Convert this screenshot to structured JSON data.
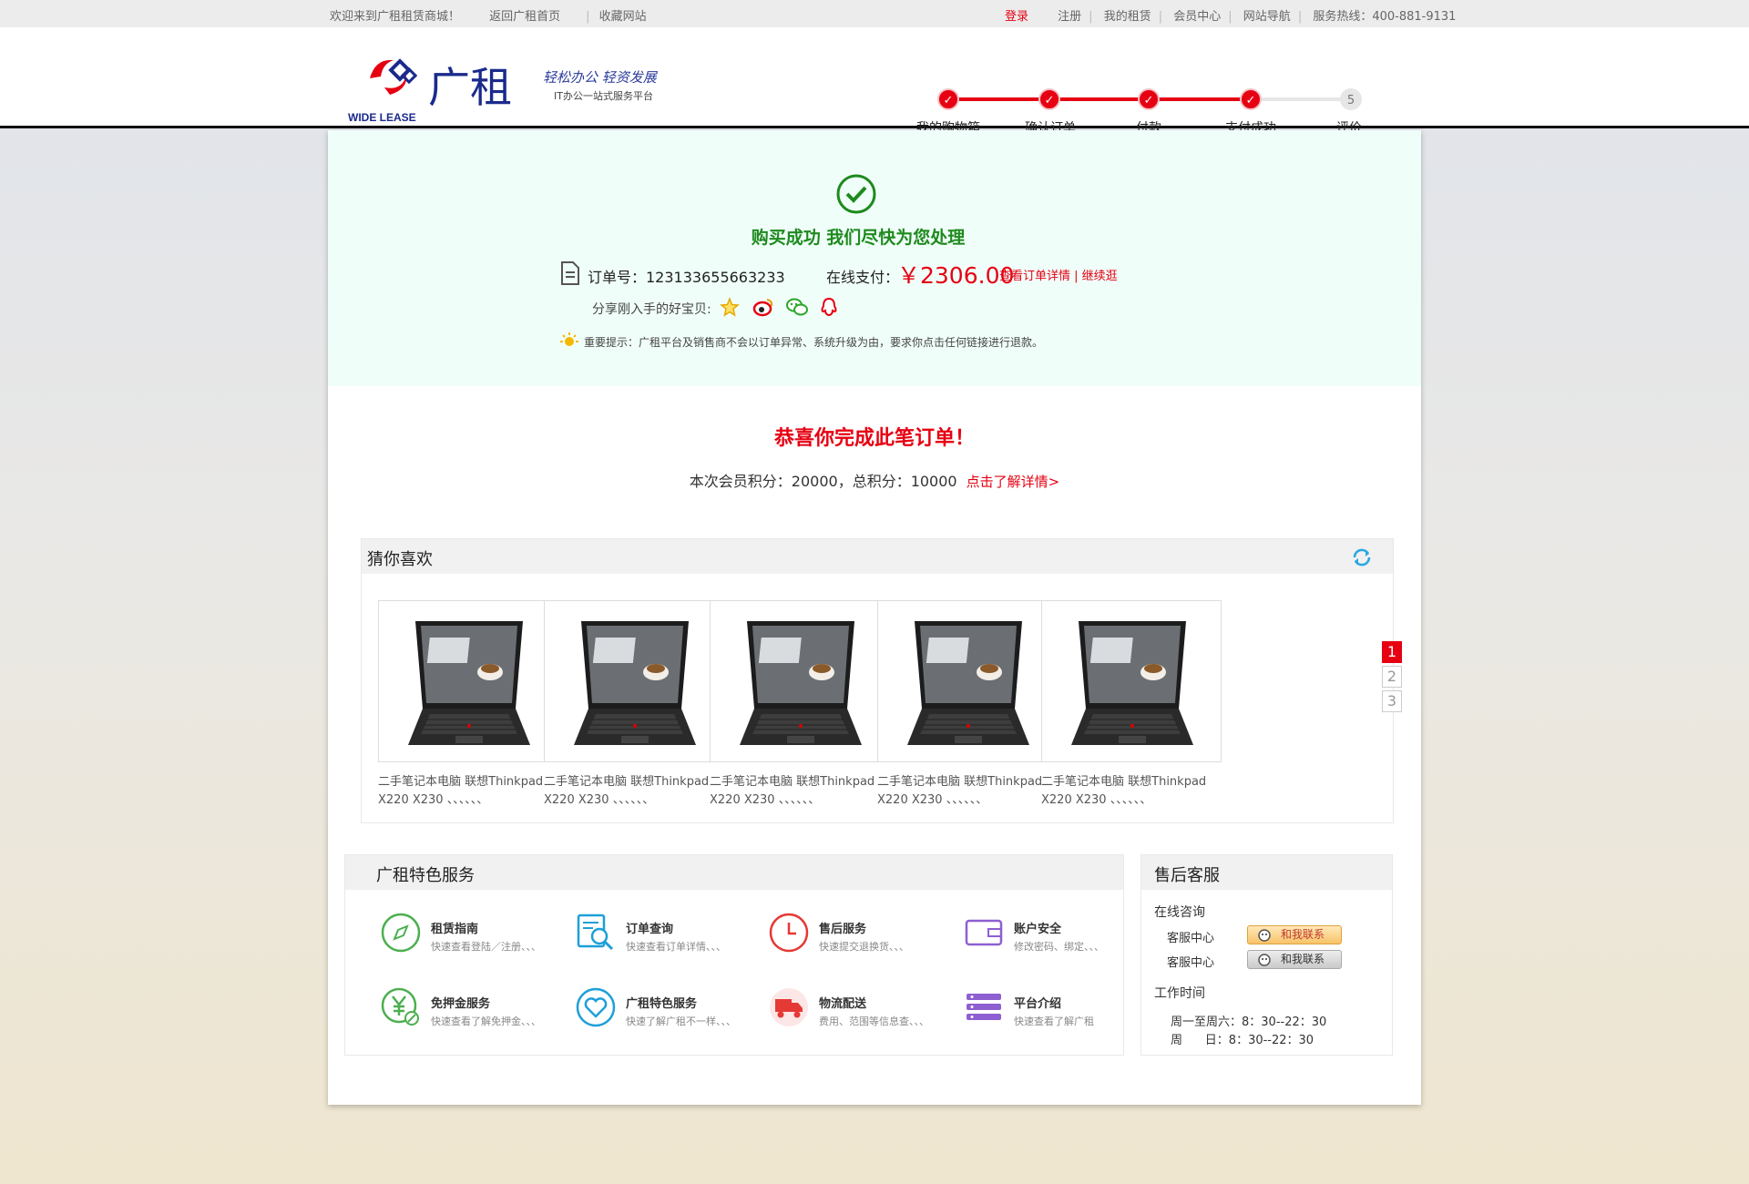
{
  "topbar": {
    "welcome": "欢迎来到广租租赁商城！",
    "home": "返回广租首页",
    "favorite": "收藏网站",
    "login": "登录",
    "register": "注册",
    "my_lease": "我的租赁",
    "member": "会员中心",
    "nav": "网站导航",
    "hotline": "服务热线：400-881-9131"
  },
  "header": {
    "logo_en": "WIDE LEASE",
    "logo_cn": "广租",
    "slogan_1": "轻松办公 轻资发展",
    "slogan_2": "IT办公一站式服务平台"
  },
  "steps": [
    {
      "label": "我的购物箱",
      "state": "done"
    },
    {
      "label": "确认订单",
      "state": "done"
    },
    {
      "label": "付款",
      "state": "done"
    },
    {
      "label": "支付成功",
      "state": "current"
    },
    {
      "label": "评价",
      "state": "todo",
      "num": "5"
    }
  ],
  "success": {
    "title": "购买成功 我们尽快为您处理",
    "order_label": "订单号：123133655663233",
    "pay_label": "在线支付：",
    "amount": "￥2306.00",
    "links": "查看订单详情 | 继续逛",
    "share_label": "分享刚入手的好宝贝:",
    "tip": "重要提示：广租平台及销售商不会以订单异常、系统升级为由，要求你点击任何链接进行退款。"
  },
  "congrats": {
    "title": "恭喜你完成此笔订单！",
    "points": "本次会员积分：20000，总积分：10000",
    "more": "点击了解详情>"
  },
  "guess": {
    "title": "猜你喜欢",
    "products": [
      {
        "name": "二手笔记本电脑 联想Thinkpad X220 X230 、、、、、、"
      },
      {
        "name": "二手笔记本电脑 联想Thinkpad X220 X230 、、、、、、"
      },
      {
        "name": "二手笔记本电脑 联想Thinkpad X220 X230 、、、、、、"
      },
      {
        "name": "二手笔记本电脑 联想Thinkpad X220 X230 、、、、、、"
      },
      {
        "name": "二手笔记本电脑 联想Thinkpad X220 X230 、、、、、、"
      }
    ],
    "pages": [
      "1",
      "2",
      "3"
    ]
  },
  "services": {
    "title": "广租特色服务",
    "items": [
      {
        "title": "租赁指南",
        "desc": "快速查看登陆／注册、、、",
        "icon": "compass-icon",
        "color": "#4caf50"
      },
      {
        "title": "订单查询",
        "desc": "快速查看订单详情、、、",
        "icon": "order-search-icon",
        "color": "#1e9fd8"
      },
      {
        "title": "售后服务",
        "desc": "快速提交退换货、、、",
        "icon": "clock-icon",
        "color": "#e53935"
      },
      {
        "title": "账户安全",
        "desc": "修改密码、绑定、、、",
        "icon": "wallet-icon",
        "color": "#8e5fd1"
      },
      {
        "title": "免押金服务",
        "desc": "快速查看了解免押金、、、",
        "icon": "yuan-icon",
        "color": "#4caf50"
      },
      {
        "title": "广租特色服务",
        "desc": "快速了解广租不一样、、、",
        "icon": "heart-icon",
        "color": "#1e9fd8"
      },
      {
        "title": "物流配送",
        "desc": "费用、范围等信息查、、、",
        "icon": "truck-icon",
        "color": "#e53935"
      },
      {
        "title": "平台介绍",
        "desc": "快速查看了解广租",
        "icon": "list-icon",
        "color": "#8e5fd1"
      }
    ]
  },
  "after_sales": {
    "title": "售后客服",
    "online": "在线咨询",
    "agents": [
      {
        "name": "客服中心",
        "button": "和我联系",
        "state": "online"
      },
      {
        "name": "客服中心",
        "button": "和我联系",
        "state": "offline"
      }
    ],
    "hours_label": "工作时间",
    "hours_1": "周一至周六：8：30--22：30",
    "hours_2": "周      日：8：30--22：30"
  },
  "colors": {
    "accent": "#e60012",
    "success_green": "#1e8a1e",
    "success_bg": "#f0fef9",
    "panel_bg": "#f1f1f1"
  }
}
